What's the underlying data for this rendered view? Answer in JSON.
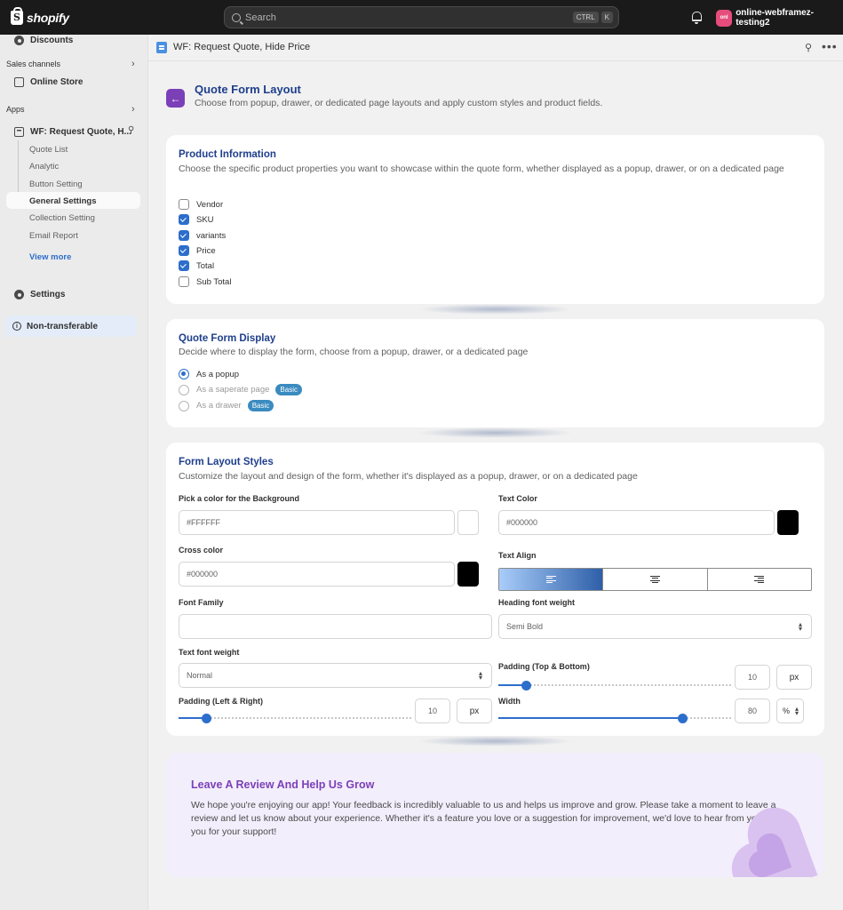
{
  "topbar": {
    "logo_text": "shopify",
    "search_placeholder": "Search",
    "kbd_ctrl": "CTRL",
    "kbd_k": "K",
    "store_avatar": "onl",
    "store_name": "online-webframez-testing2"
  },
  "sidebar": {
    "discounts": "Discounts",
    "sales_channels": "Sales channels",
    "online_store": "Online Store",
    "apps": "Apps",
    "app_name": "WF: Request Quote, H...",
    "sub_items": [
      "Quote List",
      "Analytic",
      "Button Setting",
      "General Settings",
      "Collection Setting",
      "Email Report"
    ],
    "view_more": "View more",
    "settings": "Settings",
    "non_transferable": "Non-transferable"
  },
  "header": {
    "title": "WF: Request Quote, Hide Price",
    "more": "•••"
  },
  "page": {
    "back_arrow": "←",
    "title": "Quote Form Layout",
    "subtitle": "Choose from popup, drawer, or dedicated page layouts and apply custom styles and product fields."
  },
  "product_info": {
    "title": "Product Information",
    "description": "Choose the specific product properties you want to showcase within the quote form, whether displayed as a popup, drawer, or on a dedicated page",
    "fields": [
      {
        "label": "Vendor",
        "checked": false
      },
      {
        "label": "SKU",
        "checked": true
      },
      {
        "label": "variants",
        "checked": true
      },
      {
        "label": "Price",
        "checked": true
      },
      {
        "label": "Total",
        "checked": true
      },
      {
        "label": "Sub Total",
        "checked": false
      }
    ]
  },
  "form_display": {
    "title": "Quote Form Display",
    "description": "Decide where to display the form, choose from a popup, drawer, or a dedicated page",
    "options": [
      {
        "label": "As a popup",
        "selected": true,
        "badge": ""
      },
      {
        "label": "As a saperate page",
        "selected": false,
        "badge": "Basic"
      },
      {
        "label": "As a drawer",
        "selected": false,
        "badge": "Basic"
      }
    ]
  },
  "layout_styles": {
    "title": "Form Layout Styles",
    "description": "Customize the layout and design of the form, whether it's displayed as a popup, drawer, or on a dedicated page",
    "bg_label": "Pick a color for the Background",
    "bg_value": "#FFFFFF",
    "bg_color": "#FFFFFF",
    "text_color_label": "Text Color",
    "text_color_value": "#000000",
    "text_color": "#000000",
    "cross_label": "Cross color",
    "cross_value": "#000000",
    "cross_color": "#000000",
    "text_align_label": "Text Align",
    "text_align_selected": "left",
    "font_family_label": "Font Family",
    "font_family_value": "",
    "heading_weight_label": "Heading font weight",
    "heading_weight_value": "Semi Bold",
    "text_weight_label": "Text font weight",
    "text_weight_value": "Normal",
    "padding_tb_label": "Padding (Top & Bottom)",
    "padding_tb_value": "10",
    "padding_tb_unit": "px",
    "padding_lr_label": "Padding (Left & Right)",
    "padding_lr_value": "10",
    "padding_lr_unit": "px",
    "width_label": "Width",
    "width_value": "80",
    "width_unit": "%",
    "select_arrow": "⌃⌄"
  },
  "review": {
    "title": "Leave A Review And Help Us Grow",
    "text": "We hope you're enjoying our app! Your feedback is incredibly valuable to us and helps us improve and grow. Please take a moment to leave a review and let us know about your experience. Whether it's a feature you love or a suggestion for improvement, we'd love to hear from you. Thank you for your support!"
  },
  "colors": {
    "topbar": "#1a1a1a",
    "accent_blue": "#2c6ecb",
    "title_blue": "#1f3f8c",
    "purple": "#7b3fb8"
  }
}
